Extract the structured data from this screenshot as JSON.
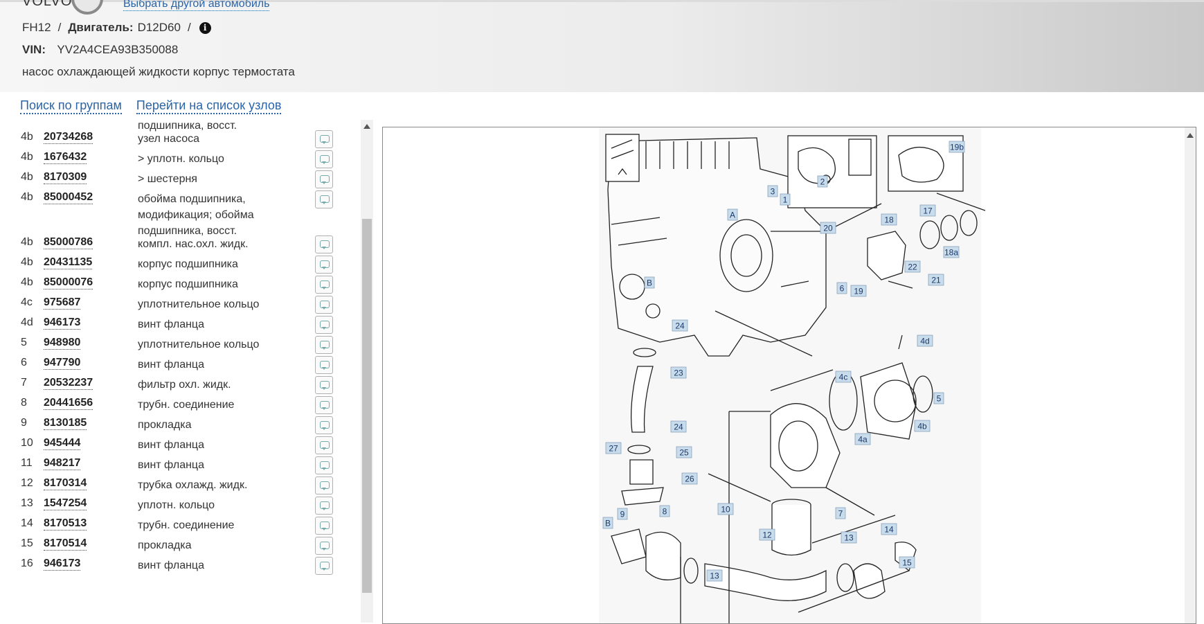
{
  "header": {
    "logo_text": "VOLVO",
    "top_link": "Выбрать другой автомобиль",
    "model": "FH12",
    "engine_label": "Двигатель:",
    "engine_value": "D12D60",
    "vin_label": "VIN:",
    "vin_value": "YV2A4CEA93B350088",
    "subtitle": "насос охлаждающей жидкости корпус термостата"
  },
  "nav": {
    "search_groups": "Поиск по группам",
    "go_to_nodes": "Перейти на список узлов"
  },
  "parts_fragment": "подшипника, восст.",
  "parts": [
    {
      "pos": "4b",
      "num": "20734268",
      "desc": "узел насоса"
    },
    {
      "pos": "4b",
      "num": "1676432",
      "desc": "> уплотн. кольцо"
    },
    {
      "pos": "4b",
      "num": "8170309",
      "desc": "> шестерня"
    },
    {
      "pos": "4b",
      "num": "85000452",
      "desc": "обойма подшипника, модификация; обойма подшипника, восст."
    },
    {
      "pos": "4b",
      "num": "85000786",
      "desc": "компл. нас.охл. жидк."
    },
    {
      "pos": "4b",
      "num": "20431135",
      "desc": "корпус подшипника"
    },
    {
      "pos": "4b",
      "num": "85000076",
      "desc": "корпус подшипника"
    },
    {
      "pos": "4c",
      "num": "975687",
      "desc": "уплотнительное кольцо"
    },
    {
      "pos": "4d",
      "num": "946173",
      "desc": "винт фланца"
    },
    {
      "pos": "5",
      "num": "948980",
      "desc": "уплотнительное кольцо"
    },
    {
      "pos": "6",
      "num": "947790",
      "desc": "винт фланца"
    },
    {
      "pos": "7",
      "num": "20532237",
      "desc": "фильтр охл. жидк."
    },
    {
      "pos": "8",
      "num": "20441656",
      "desc": "трубн. соединение"
    },
    {
      "pos": "9",
      "num": "8130185",
      "desc": "прокладка"
    },
    {
      "pos": "10",
      "num": "945444",
      "desc": "винт фланца"
    },
    {
      "pos": "11",
      "num": "948217",
      "desc": "винт фланца"
    },
    {
      "pos": "12",
      "num": "8170314",
      "desc": "трубка охлажд. жидк."
    },
    {
      "pos": "13",
      "num": "1547254",
      "desc": "уплотн. кольцо"
    },
    {
      "pos": "14",
      "num": "8170513",
      "desc": "трубн. соединение"
    },
    {
      "pos": "15",
      "num": "8170514",
      "desc": "прокладка"
    },
    {
      "pos": "16",
      "num": "946173",
      "desc": "винт фланца"
    }
  ],
  "diagram_callouts": [
    "1",
    "2",
    "3",
    "19b",
    "20",
    "18",
    "17",
    "18a",
    "22",
    "21",
    "6",
    "19",
    "A",
    "B",
    "24",
    "23",
    "4d",
    "4c",
    "5",
    "4b",
    "24",
    "27",
    "25",
    "4a",
    "26",
    "10",
    "9",
    "8",
    "12",
    "7",
    "13",
    "14",
    "15",
    "13",
    "B"
  ]
}
